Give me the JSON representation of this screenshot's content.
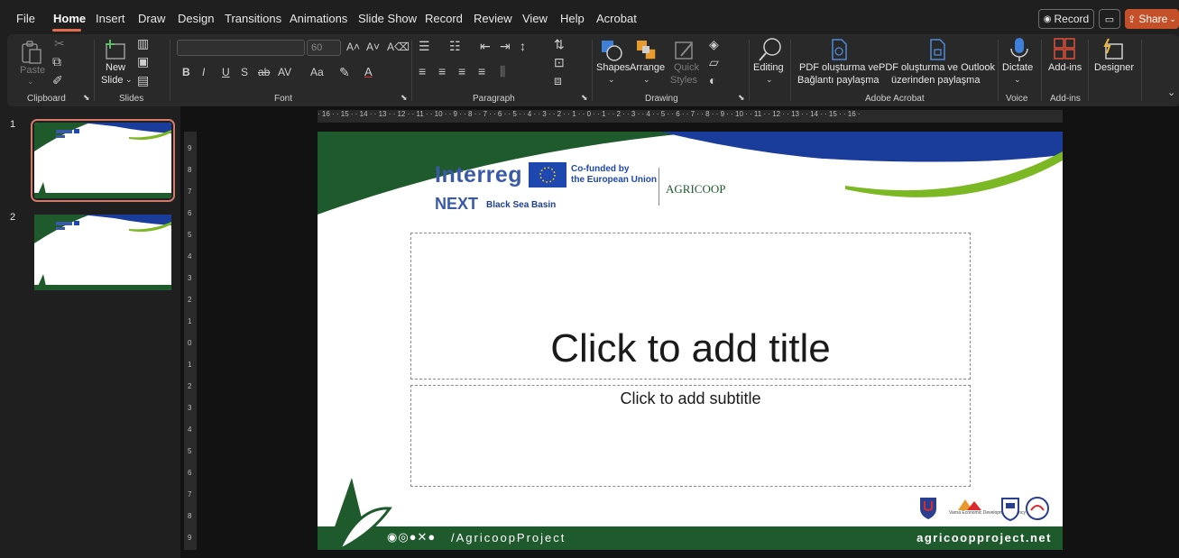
{
  "menu": {
    "items": [
      "File",
      "Home",
      "Insert",
      "Draw",
      "Design",
      "Transitions",
      "Animations",
      "Slide Show",
      "Record",
      "Review",
      "View",
      "Help",
      "Acrobat"
    ],
    "active": "Home",
    "record_label": "Record",
    "share_label": "Share"
  },
  "ribbon": {
    "groups": {
      "clipboard": "Clipboard",
      "slides": "Slides",
      "font": "Font",
      "paragraph": "Paragraph",
      "drawing": "Drawing",
      "adobe": "Adobe Acrobat",
      "voice": "Voice",
      "addins": "Add-ins"
    },
    "paste": "Paste",
    "new_slide_1": "New",
    "new_slide_2": "Slide",
    "font_size": "60",
    "shapes": "Shapes",
    "arrange": "Arrange",
    "quick_styles_1": "Quick",
    "quick_styles_2": "Styles",
    "editing": "Editing",
    "pdf1_line1": "PDF oluşturma ve",
    "pdf1_line2": "Bağlantı paylaşma",
    "pdf2_line1": "PDF oluşturma ve Outlook",
    "pdf2_line2": "üzerinden paylaşma",
    "dictate": "Dictate",
    "addins_btn": "Add-ins",
    "designer": "Designer"
  },
  "thumbnails": [
    {
      "number": "1",
      "selected": true
    },
    {
      "number": "2",
      "selected": false
    }
  ],
  "ruler": {
    "horizontal": "· 16 · · 15 · · 14 · · 13 · · 12 · · 11 · · 10 · · 9 · · 8 · · 7 · · 6 · · 5 · · 4 · · 3 · · 2 · · 1 · · 0 · · 1 · · 2 · · 3 · · 4 · · 5 · · 6 · · 7 · · 8 · · 9 · · 10 · · 11 · · 12 · · 13 · · 14 · · 15 · · 16 ·",
    "vertical": [
      "9",
      "8",
      "7",
      "6",
      "5",
      "4",
      "3",
      "2",
      "1",
      "0",
      "1",
      "2",
      "3",
      "4",
      "5",
      "6",
      "7",
      "8",
      "9"
    ]
  },
  "slide": {
    "title_placeholder": "Click to add title",
    "subtitle_placeholder": "Click to add subtitle",
    "logos": {
      "interreg": "Interreg",
      "next": "NEXT",
      "black_sea": "Black Sea Basin",
      "eu_line1": "Co-funded by",
      "eu_line2": "the European Union",
      "agricoop": "AGRICOOP"
    },
    "partners": [
      "Varna Economic Development Agency"
    ],
    "footer_handle": "/AgricoopProject",
    "footer_site": "agricoopproject.net",
    "colors": {
      "green": "#1f5a2d",
      "blue": "#1a3d9c",
      "lime": "#7cb824"
    }
  },
  "colors": {
    "accent": "#c4502a",
    "ribbon_bg": "#292929",
    "app_bg": "#1f1f1f"
  }
}
